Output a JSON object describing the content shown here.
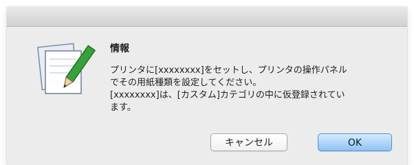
{
  "dialog": {
    "title": "情報",
    "message_lines": [
      "プリンタに[xxxxxxxx]をセットし、プリンタの操作パネル",
      "でその用紙種類を設定してください。",
      "[xxxxxxxx]は、[カスタム]カテゴリの中に仮登録されてい",
      "ます。"
    ],
    "icon": "note-pencil-icon"
  },
  "buttons": {
    "cancel_label": "キャンセル",
    "ok_label": "OK"
  },
  "colors": {
    "dialog_bg": "#ececec",
    "default_button": "#8ec3f5",
    "default_button_border": "#4a90d9",
    "pencil": "#39a13a"
  }
}
